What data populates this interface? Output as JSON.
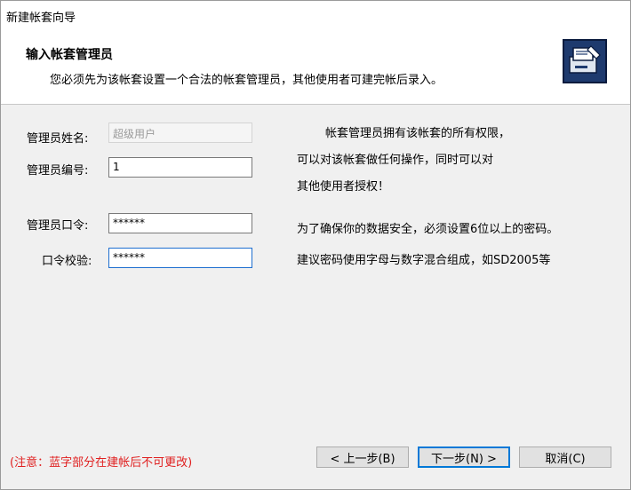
{
  "window": {
    "title": "新建帐套向导"
  },
  "header": {
    "title": "输入帐套管理员",
    "subtitle": "您必须先为该帐套设置一个合法的帐套管理员，其他使用者可建完帐后录入。",
    "icon": "wizard-icon"
  },
  "form": {
    "admin_name": {
      "label": "管理员姓名:",
      "value": "超级用户"
    },
    "admin_id": {
      "label": "管理员编号:",
      "value": "1"
    },
    "admin_password": {
      "label": "管理员口令:",
      "value": "******"
    },
    "password_confirm": {
      "label": "口令校验:",
      "value": "******"
    }
  },
  "info": {
    "line1": "帐套管理员拥有该帐套的所有权限，",
    "line2": "可以对该帐套做任何操作，同时可以对",
    "line3": "其他使用者授权！",
    "line4": "为了确保你的数据安全，必须设置6位以上的密码。",
    "line5": "建议密码使用字母与数字混合组成，如SD2005等"
  },
  "footer": {
    "note": "(注意：蓝字部分在建帐后不可更改)",
    "prev_label": "< 上一步(B)",
    "next_label": "下一步(N) >",
    "cancel_label": "取消(C)"
  },
  "colors": {
    "note": "#e02020",
    "default_button_border": "#0078d7"
  }
}
